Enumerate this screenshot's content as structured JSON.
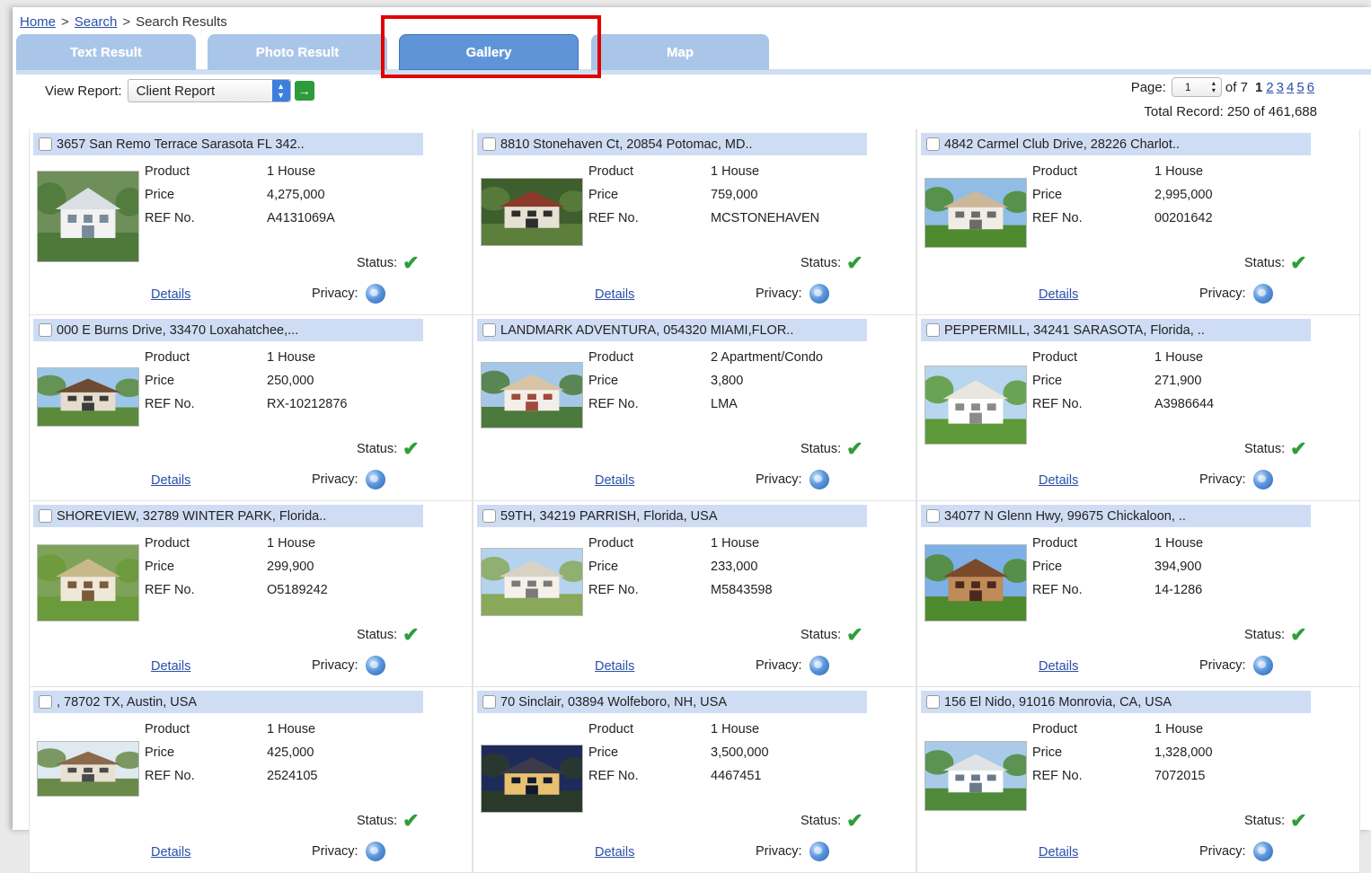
{
  "breadcrumb": {
    "home": "Home",
    "search": "Search",
    "current": "Search Results",
    "separator": ">"
  },
  "tabs": [
    {
      "label": "Text Result",
      "active": false
    },
    {
      "label": "Photo Result",
      "active": false
    },
    {
      "label": "Gallery",
      "active": true
    },
    {
      "label": "Map",
      "active": false
    }
  ],
  "report": {
    "label": "View Report:",
    "value": "Client Report",
    "go": "→"
  },
  "pager": {
    "label": "Page:",
    "current": "1",
    "of_text": "of 7",
    "pages": [
      "1",
      "2",
      "3",
      "4",
      "5",
      "6"
    ],
    "total": "Total Record: 250 of 461,688"
  },
  "card_labels": {
    "product": "Product",
    "price": "Price",
    "ref": "REF No.",
    "status": "Status:",
    "privacy": "Privacy:",
    "details": "Details",
    "check": "✔"
  },
  "listings": [
    {
      "title": "3657 San Remo Terrace Sarasota FL 342..",
      "product": "1 House",
      "price": "4,275,000",
      "ref": "A4131069A",
      "status": "ok",
      "photo": "modern-house"
    },
    {
      "title": "8810 Stonehaven Ct, 20854 Potomac, MD..",
      "product": "1 House",
      "price": "759,000",
      "ref": "MCSTONEHAVEN",
      "status": "ok",
      "photo": "colonial-house"
    },
    {
      "title": "4842 Carmel Club Drive, 28226 Charlot..",
      "product": "1 House",
      "price": "2,995,000",
      "ref": "00201642",
      "status": "ok",
      "photo": "estate-house"
    },
    {
      "title": "000 E Burns Drive, 33470 Loxahatchee,...",
      "product": "1 House",
      "price": "250,000",
      "ref": "RX-10212876",
      "status": "ok",
      "photo": "ranch-house"
    },
    {
      "title": "LANDMARK ADVENTURA, 054320 MIAMI,FLOR..",
      "product": "2 Apartment/Condo",
      "price": "3,800",
      "ref": "LMA",
      "status": "ok",
      "photo": "condo-building"
    },
    {
      "title": "PEPPERMILL, 34241 SARASOTA, Florida, ..",
      "product": "1 House",
      "price": "271,900",
      "ref": "A3986644",
      "status": "ok",
      "photo": "florida-house"
    },
    {
      "title": "SHOREVIEW, 32789 WINTER PARK, Florida..",
      "product": "1 House",
      "price": "299,900",
      "ref": "O5189242",
      "status": "ok",
      "photo": "garden-house"
    },
    {
      "title": "59TH, 34219 PARRISH, Florida, USA",
      "product": "1 House",
      "price": "233,000",
      "ref": "M5843598",
      "status": "ok",
      "photo": "suburban-house"
    },
    {
      "title": "34077 N Glenn Hwy, 99675 Chickaloon, ..",
      "product": "1 House",
      "price": "394,900",
      "ref": "14-1286",
      "status": "ok",
      "photo": "cabin-house"
    },
    {
      "title": ", 78702 TX, Austin, USA",
      "product": "1 House",
      "price": "425,000",
      "ref": "2524105",
      "status": "ok",
      "photo": "bungalow"
    },
    {
      "title": "70 Sinclair, 03894 Wolfeboro, NH, USA",
      "product": "1 House",
      "price": "3,500,000",
      "ref": "4467451",
      "status": "ok",
      "photo": "night-mansion"
    },
    {
      "title": "156 El Nido, 91016 Monrovia, CA, USA",
      "product": "1 House",
      "price": "1,328,000",
      "ref": "7072015",
      "status": "ok",
      "photo": "hillside-house"
    }
  ],
  "colors": {
    "accent": "#5f95d8",
    "tab": "#a9c5e8",
    "header_bg": "#cfddf4",
    "link": "#2a4fa8",
    "check": "#2f9e3a",
    "highlight": "#e00000"
  }
}
